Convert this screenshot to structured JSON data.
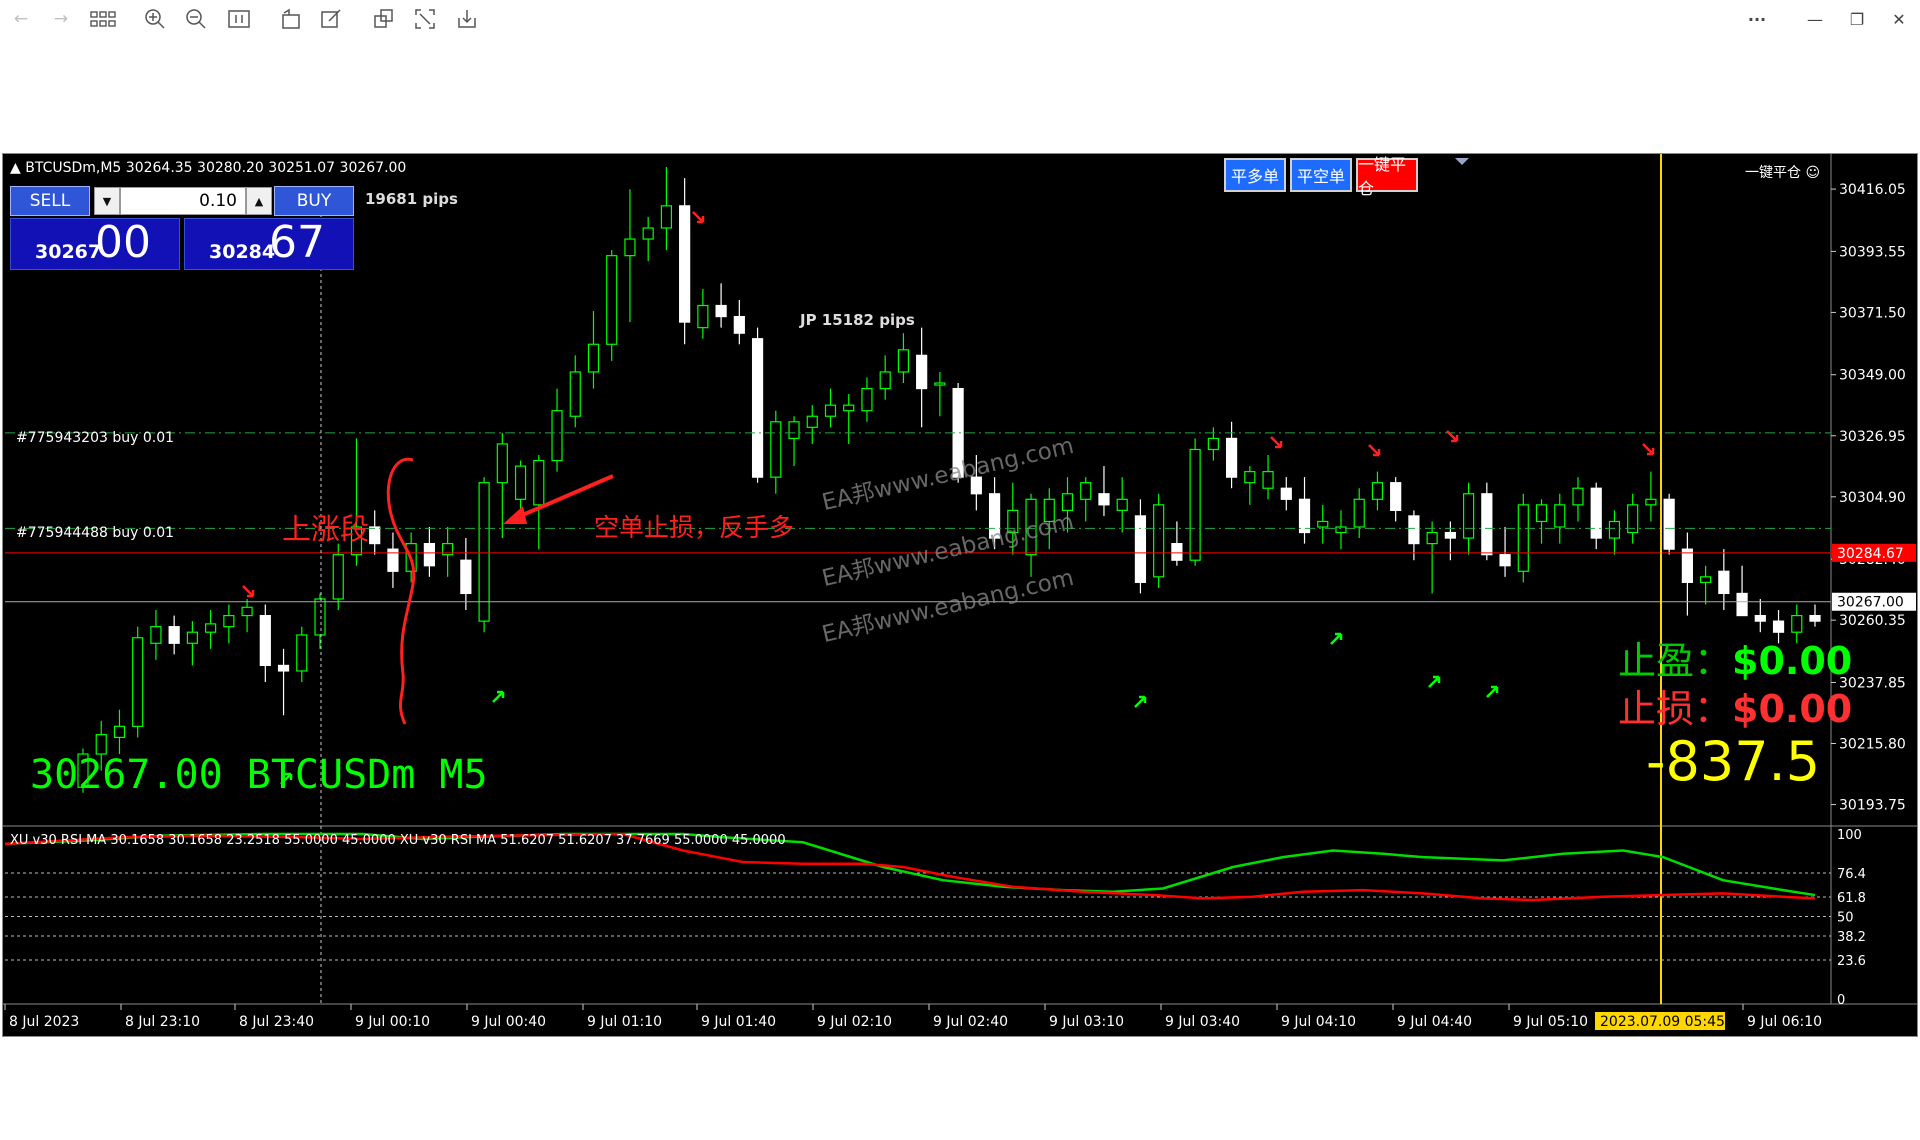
{
  "window": {
    "toolbar_icons": [
      "arrow-left-icon",
      "arrow-right-icon",
      "grid-icon",
      "zoom-in-icon",
      "zoom-out-icon",
      "fit-icon",
      "rotate-icon",
      "edit-icon",
      "copy-icon",
      "fullscreen-icon",
      "download-icon"
    ],
    "controls": {
      "more": "···",
      "minimize": "—",
      "restore": "❐",
      "close": "✕"
    }
  },
  "chart": {
    "header": "BTCUSDm,M5  30264.35 30280.20 30251.07 30267.00",
    "pips_top": "19681 pips",
    "jp_label": "JP  15182 pips",
    "big_symbol": "30267.00 BTCUSDm M5",
    "annotation_up": "上涨段",
    "annotation_reverse": "空单止损，反手多",
    "watermark": "EA邦www.eabang.com",
    "take_profit": {
      "label": "止盈：",
      "value": "$0.00"
    },
    "stop_loss": {
      "label": "止损：",
      "value": "$0.00"
    },
    "profit_big": "-837.5",
    "close_all_label": "一键平仓 ☺",
    "order_lines": [
      {
        "label": "#775943203 buy 0.01",
        "price": 30328.0
      },
      {
        "label": "#775944488 buy 0.01",
        "price": 30293.5
      }
    ],
    "price_labels": {
      "ask": "30284.67",
      "bid": "30267.00"
    },
    "colors": {
      "bull": "#00ff00",
      "bear": "#ffffff",
      "ask_line": "#ff0000",
      "cursor": "#ffd700"
    }
  },
  "trade_panel": {
    "sell_label": "SELL",
    "buy_label": "BUY",
    "volume": "0.10",
    "sell_price_small": "30267",
    "sell_price_big": "00",
    "buy_price_small": "30284",
    "buy_price_big": "67"
  },
  "buttons": {
    "close_long": "平多单",
    "close_short": "平空单",
    "close_all": "一键平仓"
  },
  "indicator": {
    "header": "XU v30 RSI MA 30.1658 30.1658 23.2518 55.0000 45.0000  XU v30 RSI MA 51.6207 51.6207 37.7669 55.0000 45.0000",
    "levels": [
      "100",
      "76.4",
      "61.8",
      "50",
      "38.2",
      "23.6",
      "0"
    ]
  },
  "time_axis": {
    "labels": [
      "8 Jul 2023",
      "8 Jul 23:10",
      "8 Jul 23:40",
      "9 Jul 00:10",
      "9 Jul 00:40",
      "9 Jul 01:10",
      "9 Jul 01:40",
      "9 Jul 02:10",
      "9 Jul 02:40",
      "9 Jul 03:10",
      "9 Jul 03:40",
      "9 Jul 04:10",
      "9 Jul 04:40",
      "9 Jul 05:10",
      "9 Jul 06:10"
    ],
    "cursor_label": "2023.07.09 05:45"
  },
  "chart_data": {
    "type": "candlestick",
    "symbol": "BTCUSDm",
    "timeframe": "M5",
    "y_ticks": [
      30416.05,
      30393.55,
      30371.5,
      30349.0,
      30326.95,
      30304.9,
      30282.4,
      30260.35,
      30237.85,
      30215.8,
      30193.75
    ],
    "y_tick_labels": [
      "30416.05",
      "30393.55",
      "30371.50",
      "30349.00",
      "30326.95",
      "30304.90",
      "30282.40",
      "30260.35",
      "30237.85",
      "30215.80",
      "30193.75"
    ],
    "ylim": [
      30186,
      30428
    ],
    "candles": [
      [
        30200,
        30214,
        30198,
        30212
      ],
      [
        30212,
        30224,
        30206,
        30219
      ],
      [
        30218,
        30228,
        30212,
        30222
      ],
      [
        30222,
        30258,
        30218,
        30254
      ],
      [
        30252,
        30264,
        30246,
        30258
      ],
      [
        30258,
        30262,
        30248,
        30252
      ],
      [
        30252,
        30260,
        30244,
        30256
      ],
      [
        30256,
        30264,
        30250,
        30259
      ],
      [
        30258,
        30266,
        30252,
        30262
      ],
      [
        30262,
        30268,
        30256,
        30265
      ],
      [
        30262,
        30266,
        30238,
        30244
      ],
      [
        30244,
        30250,
        30226,
        30242
      ],
      [
        30242,
        30258,
        30238,
        30255
      ],
      [
        30255,
        30270,
        30250,
        30268
      ],
      [
        30268,
        30288,
        30264,
        30284
      ],
      [
        30284,
        30326,
        30280,
        30294
      ],
      [
        30294,
        30300,
        30284,
        30288
      ],
      [
        30286,
        30292,
        30272,
        30278
      ],
      [
        30278,
        30292,
        30274,
        30288
      ],
      [
        30288,
        30294,
        30276,
        30280
      ],
      [
        30284,
        30294,
        30276,
        30288
      ],
      [
        30282,
        30290,
        30264,
        30270
      ],
      [
        30260,
        30312,
        30256,
        30310
      ],
      [
        30310,
        30328,
        30290,
        30324
      ],
      [
        30304,
        30318,
        30298,
        30316
      ],
      [
        30302,
        30320,
        30286,
        30318
      ],
      [
        30318,
        30344,
        30314,
        30336
      ],
      [
        30334,
        30356,
        30330,
        30350
      ],
      [
        30350,
        30372,
        30344,
        30360
      ],
      [
        30360,
        30394,
        30354,
        30392
      ],
      [
        30392,
        30416,
        30368,
        30398
      ],
      [
        30398,
        30406,
        30390,
        30402
      ],
      [
        30402,
        30424,
        30394,
        30410
      ],
      [
        30410,
        30420,
        30360,
        30368
      ],
      [
        30366,
        30380,
        30362,
        30374
      ],
      [
        30374,
        30382,
        30366,
        30370
      ],
      [
        30370,
        30376,
        30360,
        30364
      ],
      [
        30362,
        30366,
        30310,
        30312
      ],
      [
        30312,
        30336,
        30306,
        30332
      ],
      [
        30326,
        30334,
        30316,
        30332
      ],
      [
        30330,
        30338,
        30324,
        30334
      ],
      [
        30334,
        30344,
        30330,
        30338
      ],
      [
        30336,
        30342,
        30324,
        30338
      ],
      [
        30336,
        30348,
        30332,
        30344
      ],
      [
        30344,
        30356,
        30340,
        30350
      ],
      [
        30350,
        30364,
        30346,
        30358
      ],
      [
        30356,
        30366,
        30330,
        30344
      ],
      [
        30346,
        30350,
        30334,
        30346
      ],
      [
        30344,
        30346,
        30310,
        30312
      ],
      [
        30312,
        30320,
        30300,
        30306
      ],
      [
        30306,
        30312,
        30286,
        30290
      ],
      [
        30292,
        30310,
        30284,
        30300
      ],
      [
        30284,
        30306,
        30276,
        30304
      ],
      [
        30296,
        30308,
        30286,
        30304
      ],
      [
        30300,
        30312,
        30292,
        30306
      ],
      [
        30304,
        30312,
        30296,
        30310
      ],
      [
        30306,
        30316,
        30298,
        30302
      ],
      [
        30300,
        30312,
        30292,
        30304
      ],
      [
        30298,
        30304,
        30270,
        30274
      ],
      [
        30276,
        30306,
        30272,
        30302
      ],
      [
        30288,
        30296,
        30280,
        30282
      ],
      [
        30282,
        30326,
        30280,
        30322
      ],
      [
        30322,
        30330,
        30318,
        30326
      ],
      [
        30326,
        30332,
        30308,
        30312
      ],
      [
        30310,
        30316,
        30302,
        30314
      ],
      [
        30308,
        30320,
        30304,
        30314
      ],
      [
        30308,
        30312,
        30300,
        30304
      ],
      [
        30304,
        30312,
        30288,
        30292
      ],
      [
        30294,
        30302,
        30288,
        30296
      ],
      [
        30292,
        30300,
        30286,
        30294
      ],
      [
        30294,
        30308,
        30290,
        30304
      ],
      [
        30304,
        30314,
        30300,
        30310
      ],
      [
        30310,
        30312,
        30296,
        30300
      ],
      [
        30298,
        30300,
        30282,
        30288
      ],
      [
        30288,
        30296,
        30270,
        30292
      ],
      [
        30292,
        30296,
        30282,
        30290
      ],
      [
        30290,
        30310,
        30284,
        30306
      ],
      [
        30306,
        30310,
        30282,
        30284
      ],
      [
        30284,
        30294,
        30276,
        30280
      ],
      [
        30278,
        30306,
        30274,
        30302
      ],
      [
        30296,
        30304,
        30288,
        30302
      ],
      [
        30294,
        30306,
        30288,
        30302
      ],
      [
        30302,
        30312,
        30296,
        30308
      ],
      [
        30308,
        30310,
        30286,
        30290
      ],
      [
        30290,
        30300,
        30284,
        30296
      ],
      [
        30292,
        30306,
        30288,
        30302
      ],
      [
        30302,
        30314,
        30296,
        30304
      ],
      [
        30304,
        30306,
        30284,
        30286
      ],
      [
        30286,
        30292,
        30262,
        30274
      ],
      [
        30274,
        30280,
        30266,
        30276
      ],
      [
        30278,
        30286,
        30264,
        30270
      ],
      [
        30270,
        30280,
        30262,
        30262
      ],
      [
        30262,
        30268,
        30256,
        30260
      ],
      [
        30260,
        30264,
        30252,
        30256
      ],
      [
        30256,
        30266,
        30252,
        30262
      ],
      [
        30262,
        30266,
        30258,
        30260
      ]
    ]
  }
}
